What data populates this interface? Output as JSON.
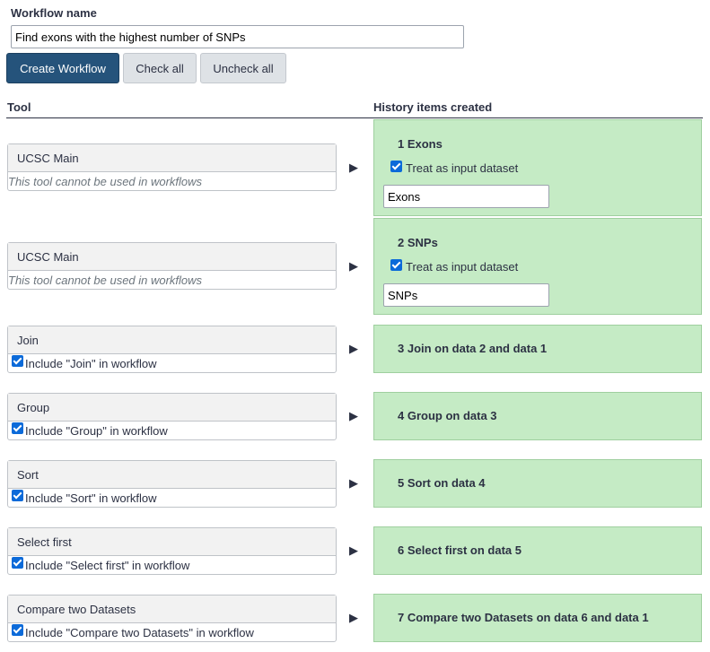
{
  "workflow": {
    "name_label": "Workflow name",
    "name_value": "Find exons with the highest number of SNPs"
  },
  "buttons": {
    "create": "Create Workflow",
    "check_all": "Check all",
    "uncheck_all": "Uncheck all"
  },
  "headers": {
    "tool": "Tool",
    "history": "History items created"
  },
  "arrow_glyph": "▶",
  "rows": [
    {
      "tool": "UCSC Main",
      "tool_note": "This tool cannot be used in workflows",
      "history_title": "1 Exons",
      "input_label": "Treat as input dataset",
      "input_value": "Exons"
    },
    {
      "tool": "UCSC Main",
      "tool_note": "This tool cannot be used in workflows",
      "history_title": "2 SNPs",
      "input_label": "Treat as input dataset",
      "input_value": "SNPs"
    },
    {
      "tool": "Join",
      "include_label": "Include \"Join\" in workflow",
      "history_title": "3 Join on data 2 and data 1"
    },
    {
      "tool": "Group",
      "include_label": "Include \"Group\" in workflow",
      "history_title": "4 Group on data 3"
    },
    {
      "tool": "Sort",
      "include_label": "Include \"Sort\" in workflow",
      "history_title": "5 Sort on data 4"
    },
    {
      "tool": "Select first",
      "include_label": "Include \"Select first\" in workflow",
      "history_title": "6 Select first on data 5"
    },
    {
      "tool": "Compare two Datasets",
      "include_label": "Include \"Compare two Datasets\" in workflow",
      "history_title": "7 Compare two Datasets on data 6 and data 1"
    }
  ],
  "colors": {
    "primary": "#25537b",
    "history_bg": "#c5ebc5",
    "checkbox": "#0b6ad9"
  }
}
